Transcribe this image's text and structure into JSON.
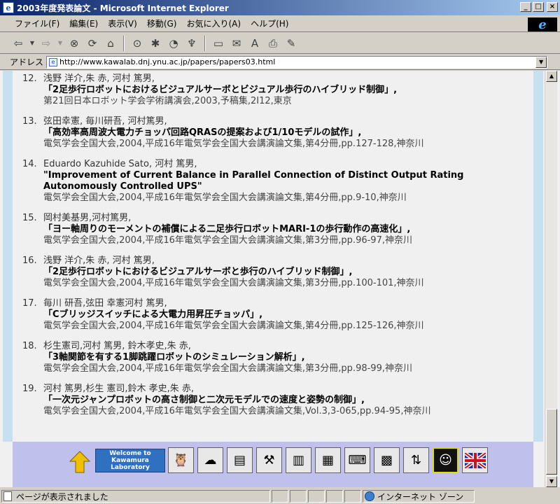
{
  "window": {
    "title": "2003年度発表論文 - Microsoft Internet Explorer",
    "minimize": "_",
    "maximize": "□",
    "close": "×"
  },
  "menu": [
    "ファイル(F)",
    "編集(E)",
    "表示(V)",
    "移動(G)",
    "お気に入り(A)",
    "ヘルプ(H)"
  ],
  "toolbar": {
    "back_icon": "back-arrow-icon",
    "forward_icon": "forward-arrow-icon",
    "stop_icon": "stop-icon",
    "refresh_icon": "refresh-icon",
    "home_icon": "home-icon"
  },
  "address": {
    "label": "アドレス",
    "url": "http://www.kawalab.dnj.ynu.ac.jp/papers/papers03.html"
  },
  "papers": [
    {
      "num": "12.",
      "authors": "浅野 洋介,朱 赤, 河村 篤男,",
      "title": "「2足歩行ロボットにおけるビジュアルサーボとビジュアル歩行のハイブリッド制御」,",
      "venue": "第21回日本ロボット学会学術講演会,2003,予稿集,2I12,東京"
    },
    {
      "num": "13.",
      "authors": "弦田幸憲, 毎川研吾, 河村篤男,",
      "title": "「高効率高周波大電力チョッパ回路QRASの提案および1/10モデルの試作」,",
      "venue": "電気学会全国大会,2004,平成16年電気学会全国大会講演論文集,第4分冊,pp.127-128,神奈川"
    },
    {
      "num": "14.",
      "authors": "Eduardo Kazuhide Sato, 河村 篤男,",
      "title": "\"Improvement of Current Balance in Parallel Connection of Distinct Output Rating Autonomously Controlled UPS\"",
      "venue": "電気学会全国大会,2004,平成16年電気学会全国大会講演論文集,第4分冊,pp.9-10,神奈川"
    },
    {
      "num": "15.",
      "authors": "岡村美基男,河村篤男,",
      "title": "「ヨー軸周りのモーメントの補償による二足歩行ロボットMARI-1の歩行動作の高速化」,",
      "venue": "電気学会全国大会,2004,平成16年電気学会全国大会講演論文集,第3分冊,pp.96-97,神奈川"
    },
    {
      "num": "16.",
      "authors": "浅野 洋介,朱 赤, 河村 篤男,",
      "title": "「2足歩行ロボットにおけるビジュアルサーボと歩行のハイブリッド制御」,",
      "venue": "電気学会全国大会,2004,平成16年電気学会全国大会講演論文集,第3分冊,pp.100-101,神奈川"
    },
    {
      "num": "17.",
      "authors": "毎川 研吾,弦田 幸憲河村 篤男,",
      "title": "「Cブリッジスイッチによる大電力用昇圧チョッパ」,",
      "venue": "電気学会全国大会,2004,平成16年電気学会全国大会講演論文集,第4分冊,pp.125-126,神奈川"
    },
    {
      "num": "18.",
      "authors": "杉生憲司,河村 篤男, 鈴木孝史,朱 赤,",
      "title": "「3軸関節を有する1脚跳躍ロボットのシミュレーション解析」,",
      "venue": "電気学会全国大会,2004,平成16年電気学会全国大会講演論文集,第3分冊,pp.98-99,神奈川"
    },
    {
      "num": "19.",
      "authors": "河村 篤男,杉生 憲司,鈴木 孝史,朱 赤,",
      "title": "「一次元ジャンプロボットの高さ制御と二次元モデルでの速度と姿勢の制御」,",
      "venue": "電気学会全国大会,2004,平成16年電気学会全国大会講演論文集,Vol.3,3-065,pp.94-95,神奈川"
    }
  ],
  "bottom_nav": {
    "banner": "Welcome to Kawamura Laboratory",
    "icons": [
      "owl-icon",
      "brain-icon",
      "chart-icon",
      "tools-icon",
      "books-icon",
      "cabinet-icon",
      "keyboard-icon",
      "map-icon",
      "signpost-icon",
      "person-icon",
      "uk-flag-icon"
    ]
  },
  "status": {
    "message": "ページが表示されました",
    "zone": "インターネット ゾーン"
  }
}
